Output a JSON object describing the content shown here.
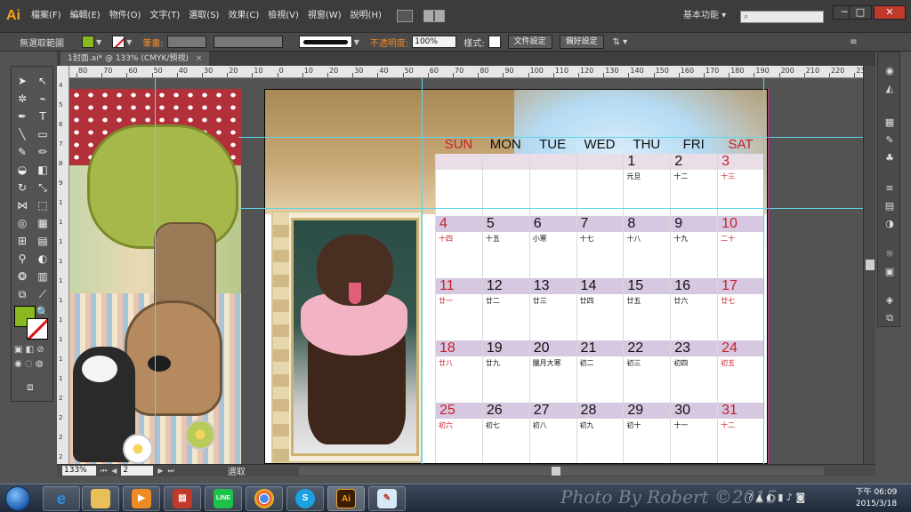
{
  "app": {
    "logo": "Ai"
  },
  "menu": [
    "檔案(F)",
    "編輯(E)",
    "物件(O)",
    "文字(T)",
    "選取(S)",
    "效果(C)",
    "檢視(V)",
    "視窗(W)",
    "說明(H)"
  ],
  "workspace": "基本功能",
  "window_controls": {
    "minimize": "─",
    "restore": "□",
    "close": "✕"
  },
  "controlbar": {
    "selection_label": "無選取範圍",
    "stroke_label": "筆畫:",
    "opacity_label": "不透明度:",
    "opacity_value": "100%",
    "style_label": "樣式:",
    "doc_setup_btn": "文件設定",
    "prefs_btn": "偏好設定"
  },
  "colors": {
    "fill": "#8ab81f",
    "stroke_none": "#d11111",
    "accent_orange": "#f08a24",
    "guide": "#5fd3e8"
  },
  "tab": {
    "title": "1封面.ai* @ 133% (CMYK/預視)",
    "close": "×"
  },
  "ruler_h_ticks": [
    "80",
    "70",
    "60",
    "50",
    "40",
    "30",
    "20",
    "10",
    "0",
    "10",
    "20",
    "30",
    "40",
    "50",
    "60",
    "70",
    "80",
    "90",
    "100",
    "110",
    "120",
    "130",
    "140",
    "150",
    "160",
    "170",
    "180",
    "190",
    "200",
    "210",
    "220",
    "230"
  ],
  "ruler_v_ticks": [
    "4",
    "5",
    "6",
    "7",
    "8",
    "9",
    "1",
    "1",
    "1",
    "1",
    "1",
    "1",
    "1",
    "1",
    "1",
    "1",
    "2",
    "2",
    "2",
    "2"
  ],
  "calendar": {
    "weekdays": [
      "SUN",
      "MON",
      "TUE",
      "WED",
      "THU",
      "FRI",
      "SAT"
    ],
    "weeks": [
      [
        {
          "d": "",
          "l": ""
        },
        {
          "d": "",
          "l": ""
        },
        {
          "d": "",
          "l": ""
        },
        {
          "d": "",
          "l": ""
        },
        {
          "d": "1",
          "l": "元旦"
        },
        {
          "d": "2",
          "l": "十二"
        },
        {
          "d": "3",
          "l": "十三"
        }
      ],
      [
        {
          "d": "4",
          "l": "十四"
        },
        {
          "d": "5",
          "l": "十五"
        },
        {
          "d": "6",
          "l": "小寒"
        },
        {
          "d": "7",
          "l": "十七"
        },
        {
          "d": "8",
          "l": "十八"
        },
        {
          "d": "9",
          "l": "十九"
        },
        {
          "d": "10",
          "l": "二十"
        }
      ],
      [
        {
          "d": "11",
          "l": "廿一"
        },
        {
          "d": "12",
          "l": "廿二"
        },
        {
          "d": "13",
          "l": "廿三"
        },
        {
          "d": "14",
          "l": "廿四"
        },
        {
          "d": "15",
          "l": "廿五"
        },
        {
          "d": "16",
          "l": "廿六"
        },
        {
          "d": "17",
          "l": "廿七"
        }
      ],
      [
        {
          "d": "18",
          "l": "廿八"
        },
        {
          "d": "19",
          "l": "廿九"
        },
        {
          "d": "20",
          "l": "臘月大寒"
        },
        {
          "d": "21",
          "l": "初二"
        },
        {
          "d": "22",
          "l": "初三"
        },
        {
          "d": "23",
          "l": "初四"
        },
        {
          "d": "24",
          "l": "初五"
        }
      ],
      [
        {
          "d": "25",
          "l": "初六"
        },
        {
          "d": "26",
          "l": "初七"
        },
        {
          "d": "27",
          "l": "初八"
        },
        {
          "d": "28",
          "l": "初九"
        },
        {
          "d": "29",
          "l": "初十"
        },
        {
          "d": "30",
          "l": "十一"
        },
        {
          "d": "31",
          "l": "十二"
        }
      ]
    ]
  },
  "status": {
    "zoom": "133%",
    "page": "2",
    "tool_status": "選取"
  },
  "taskbar": {
    "apps": [
      "explorer",
      "ie",
      "media-player",
      "folder-app",
      "LINE",
      "chrome",
      "skype",
      "Ai",
      "paint"
    ],
    "line_label": "LINE",
    "ai_label": "Ai",
    "watermark": "Photo By Robert ©2015",
    "clock_time": "下午 06:09",
    "clock_date": "2015/3/18"
  }
}
